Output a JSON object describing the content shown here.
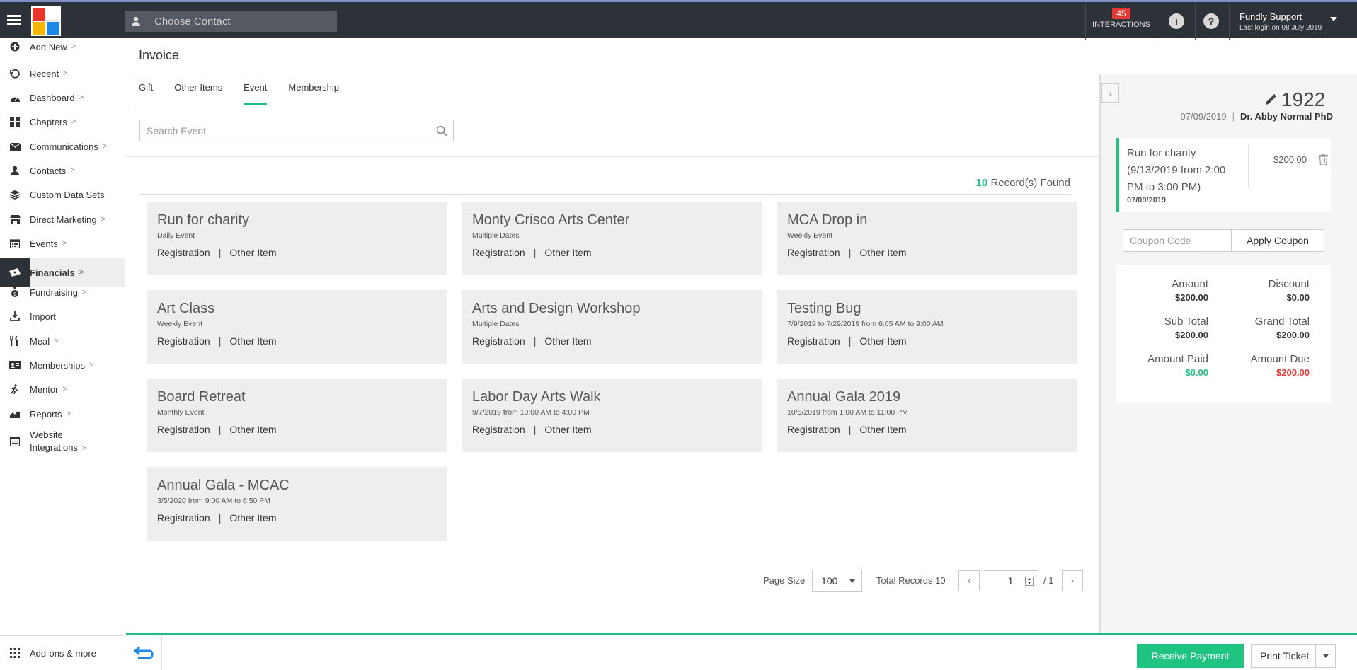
{
  "topbar": {
    "contact_placeholder": "Choose Contact",
    "interactions_count": "45",
    "interactions_label": "INTERACTIONS",
    "user_name": "Fundly Support",
    "last_login": "Last login on 08 July 2019"
  },
  "sidebar": {
    "items": [
      {
        "label": "Add New",
        "icon": "plus-circle-icon",
        "chevron": true
      },
      {
        "label": "Recent",
        "icon": "history-icon",
        "chevron": true
      },
      {
        "label": "Dashboard",
        "icon": "dashboard-icon",
        "chevron": true
      },
      {
        "label": "Chapters",
        "icon": "grid-icon",
        "chevron": true
      },
      {
        "label": "Communications",
        "icon": "envelope-icon",
        "chevron": true
      },
      {
        "label": "Contacts",
        "icon": "person-icon",
        "chevron": true
      },
      {
        "label": "Custom Data Sets",
        "icon": "layers-icon",
        "chevron": false
      },
      {
        "label": "Direct Marketing",
        "icon": "store-icon",
        "chevron": true
      },
      {
        "label": "Events",
        "icon": "calendar-icon",
        "chevron": true
      },
      {
        "label": "Financials",
        "icon": "ticket-icon",
        "chevron": true
      },
      {
        "label": "Fundraising",
        "icon": "money-bag-icon",
        "chevron": true
      },
      {
        "label": "Import",
        "icon": "import-icon",
        "chevron": false
      },
      {
        "label": "Meal",
        "icon": "fork-knife-icon",
        "chevron": true
      },
      {
        "label": "Memberships",
        "icon": "id-card-icon",
        "chevron": true
      },
      {
        "label": "Mentor",
        "icon": "walking-icon",
        "chevron": true
      },
      {
        "label": "Reports",
        "icon": "area-chart-icon",
        "chevron": true
      },
      {
        "label": "Website",
        "label2": "Integrations",
        "icon": "website-icon",
        "chevron": true
      }
    ],
    "addons": "Add-ons & more"
  },
  "page": {
    "title": "Invoice",
    "tabs": [
      "Gift",
      "Other Items",
      "Event",
      "Membership"
    ],
    "search_placeholder": "Search Event",
    "records_count": "10",
    "records_label": "Record(s) Found"
  },
  "events": [
    {
      "title": "Run for charity",
      "sub": "Daily Event"
    },
    {
      "title": "Monty Crisco Arts Center",
      "sub": "Multiple Dates"
    },
    {
      "title": "MCA Drop in",
      "sub": "Weekly Event"
    },
    {
      "title": "Art Class",
      "sub": "Weekly Event"
    },
    {
      "title": "Arts and Design Workshop",
      "sub": "Multiple Dates"
    },
    {
      "title": "Testing Bug",
      "sub": "7/9/2019 to 7/29/2019 from 6:05 AM to 9:00 AM"
    },
    {
      "title": "Board Retreat",
      "sub": "Monthly Event"
    },
    {
      "title": "Labor Day Arts Walk",
      "sub": "9/7/2019 from 10:00 AM to 4:00 PM"
    },
    {
      "title": "Annual Gala 2019",
      "sub": "10/5/2019 from 1:00 AM to 11:00 PM"
    },
    {
      "title": "Annual Gala - MCAC",
      "sub": "3/5/2020 from 9:00 AM to 6:50 PM"
    }
  ],
  "card_links": {
    "registration": "Registration",
    "other_item": "Other Item",
    "separator": "|"
  },
  "pagination": {
    "page_size_label": "Page Size",
    "page_size": "100",
    "total_records": "Total Records 10",
    "current_page": "1",
    "of_pages": "/ 1",
    "prev": "‹",
    "next": "›"
  },
  "invoice": {
    "number": "1922",
    "date": "07/09/2019",
    "separator": "|",
    "contact": "Dr. Abby Normal PhD",
    "line_item": {
      "title": "Run for charity (9/13/2019 from 2:00 PM to 3:00 PM)",
      "date": "07/09/2019",
      "amount": "$200.00"
    },
    "coupon_placeholder": "Coupon Code",
    "apply_coupon": "Apply Coupon",
    "totals": {
      "amount_label": "Amount",
      "amount": "$200.00",
      "discount_label": "Discount",
      "discount": "$0.00",
      "subtotal_label": "Sub Total",
      "subtotal": "$200.00",
      "grand_total_label": "Grand Total",
      "grand_total": "$200.00",
      "paid_label": "Amount Paid",
      "paid": "$0.00",
      "due_label": "Amount Due",
      "due": "$200.00"
    }
  },
  "footer": {
    "receive_payment": "Receive Payment",
    "print_ticket": "Print Ticket"
  },
  "colors": {
    "accent": "#1fba85",
    "topbar": "#2d3138",
    "danger": "#e53935"
  }
}
